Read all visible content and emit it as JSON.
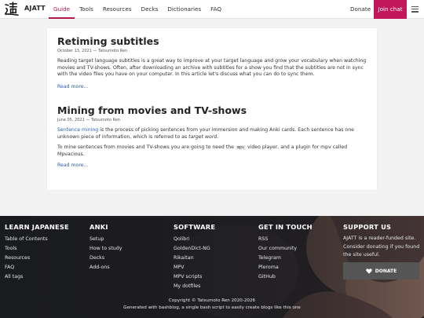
{
  "nav": {
    "brand": "AJATT",
    "links": [
      "Guide",
      "Tools",
      "Resources",
      "Decks",
      "Dictionaries",
      "FAQ"
    ],
    "active": "Guide",
    "donate": "Donate",
    "join": "Join chat",
    "accent": "#c2185b"
  },
  "posts": [
    {
      "title": "Retiming subtitles",
      "meta": "October 13, 2021 — Tatsumoto Ren",
      "body": "Reading target language subtitles is a great way to improve at your target language and grow your vocabulary when watching movies and TV-shows. Often, after downloading an archive with subtitles for a show you find that the subtitles are not in sync with the video files you have on your computer. In this article let's discuss what you can do to sync them.",
      "read_more": "Read more..."
    },
    {
      "title": "Mining from movies and TV-shows",
      "meta": "June 05, 2021 — Tatsumoto Ren",
      "link": "Sentence mining",
      "body_a": " is the process of picking sentences from your immersion and making Anki cards. Each sentence has one unknown piece of information, which is referred to as ",
      "em": "target word",
      "body_b": ".",
      "p2_a": "To mine sentences from movies and TV-shows you are going to need the ",
      "code": "mpv",
      "p2_b": " video player, and a plugin for mpv called Mpvacious.",
      "read_more": "Read more..."
    }
  ],
  "footer": {
    "learn": {
      "title": "LEARN JAPANESE",
      "links": [
        "Table of Contents",
        "Tools",
        "Resources",
        "FAQ",
        "All tags"
      ]
    },
    "anki": {
      "title": "ANKI",
      "links": [
        "Setup",
        "How to study",
        "Decks",
        "Add-ons"
      ]
    },
    "software": {
      "title": "SOFTWARE",
      "links": [
        "Qolibri",
        "GoldenDict-NG",
        "Rikaitan",
        "MPV",
        "MPV scripts",
        "My dotfiles"
      ]
    },
    "touch": {
      "title": "GET IN TOUCH",
      "links": [
        "RSS",
        "Our community",
        "Telegram",
        "Pleroma",
        "GitHub"
      ]
    },
    "support": {
      "title": "SUPPORT US",
      "text": "AJATT is a reader-funded site. Consider donating if you found the site useful.",
      "button": "DONATE"
    },
    "copyright": "Copyright © Tatsumoto Ren 2020-2026",
    "generated": "Generated with bashblog, a single bash script to easily create blogs like this one"
  }
}
